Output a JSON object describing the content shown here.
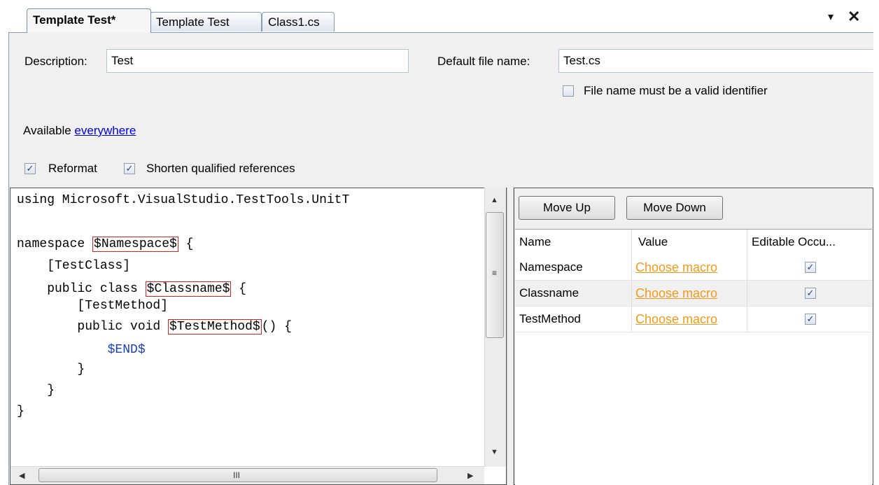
{
  "tabs": [
    {
      "label": "Template Test*"
    },
    {
      "label": "Template Test"
    },
    {
      "label": "Class1.cs"
    }
  ],
  "window": {
    "menu_glyph": "▾",
    "close_glyph": "✕"
  },
  "form": {
    "description_label": "Description:",
    "description_value": "Test",
    "default_file_label": "Default file name:",
    "default_file_value": "Test.cs",
    "valid_identifier_label": "File name must be a valid identifier",
    "valid_identifier_checked": false,
    "available_prefix": "Available",
    "available_link": "everywhere",
    "reformat_label": "Reformat",
    "reformat_checked": true,
    "shorten_label": "Shorten qualified references",
    "shorten_checked": true
  },
  "editor": {
    "line1": "using Microsoft.VisualStudio.TestTools.UnitT",
    "line3_prefix": "namespace ",
    "line3_macro": "$Namespace$",
    "line3_suffix": " {",
    "line4": "    [TestClass]",
    "line5_prefix": "    public class ",
    "line5_macro": "$Classname$",
    "line5_suffix": " {",
    "line6": "        [TestMethod]",
    "line7_prefix": "        public void ",
    "line7_macro": "$TestMethod$",
    "line7_suffix": "() {",
    "line8_indent": "            ",
    "line8_macro": "$END$",
    "line9": "        }",
    "line10": "    }",
    "line11": "}"
  },
  "params": {
    "move_up_label": "Move Up",
    "move_down_label": "Move Down",
    "columns": [
      "Name",
      "Value",
      "Editable Occu..."
    ],
    "rows": [
      {
        "name": "Namespace",
        "value": "Choose macro",
        "editable": true
      },
      {
        "name": "Classname",
        "value": "Choose macro",
        "editable": true
      },
      {
        "name": "TestMethod",
        "value": "Choose macro",
        "editable": true
      }
    ]
  },
  "colors": {
    "macro_border": "#e02020",
    "end_macro": "#1a3fbf",
    "macro_link": "#f39a1a",
    "link": "#0000ee"
  }
}
